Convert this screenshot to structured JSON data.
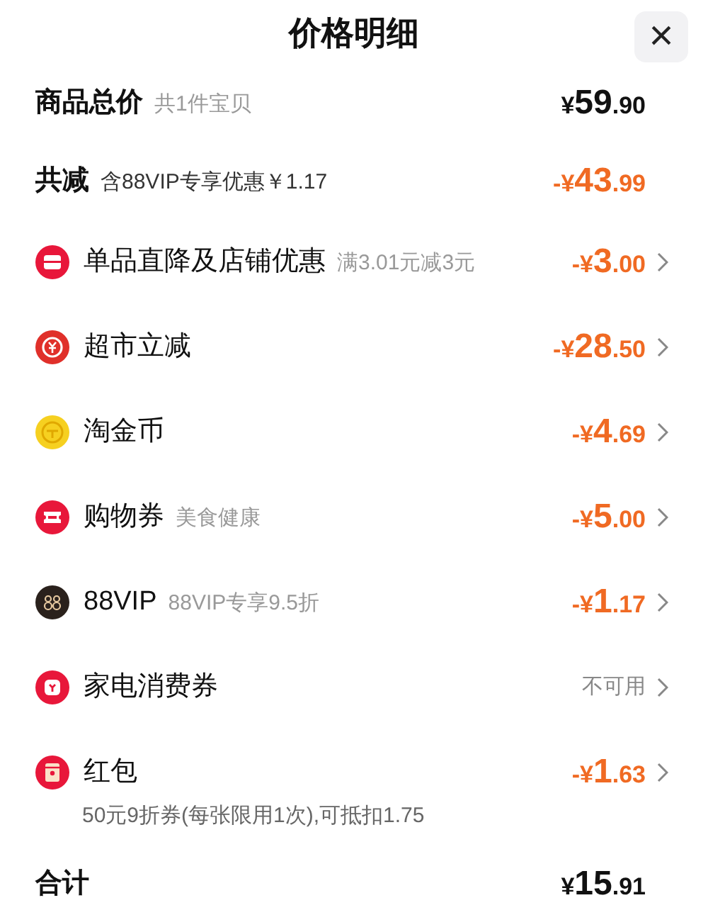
{
  "header": {
    "title": "价格明细",
    "close": "×"
  },
  "summary": [
    {
      "kind": "total",
      "label": "商品总价",
      "note": "共1件宝贝",
      "amount": "¥59.90"
    },
    {
      "kind": "discount",
      "label": "共减",
      "note": "含88VIP专享优惠￥1.17",
      "amount": "-¥43.99"
    }
  ],
  "items": [
    {
      "kind": "store",
      "label": "单品直降及店铺优惠",
      "note": "满3.01元减3元",
      "amount": "-¥3.00"
    },
    {
      "kind": "yen",
      "label": "超市立减",
      "amount": "-¥28.50"
    },
    {
      "kind": "coin",
      "label": "淘金币",
      "amount": "-¥4.69"
    },
    {
      "kind": "ticket",
      "label": "购物券",
      "note": "美食健康",
      "amount": "-¥5.00"
    },
    {
      "kind": "vip",
      "label": "88VIP",
      "note": "88VIP专享9.5折",
      "amount": "-¥1.17"
    },
    {
      "kind": "appliance",
      "label": "家电消费券",
      "status": "不可用"
    },
    {
      "kind": "redpacket",
      "label": "红包",
      "amount": "-¥1.63",
      "detail": "50元9折券(每张限用1次),可抵扣1.75"
    }
  ],
  "footer": {
    "label": "合计",
    "amount": "¥15.91"
  }
}
